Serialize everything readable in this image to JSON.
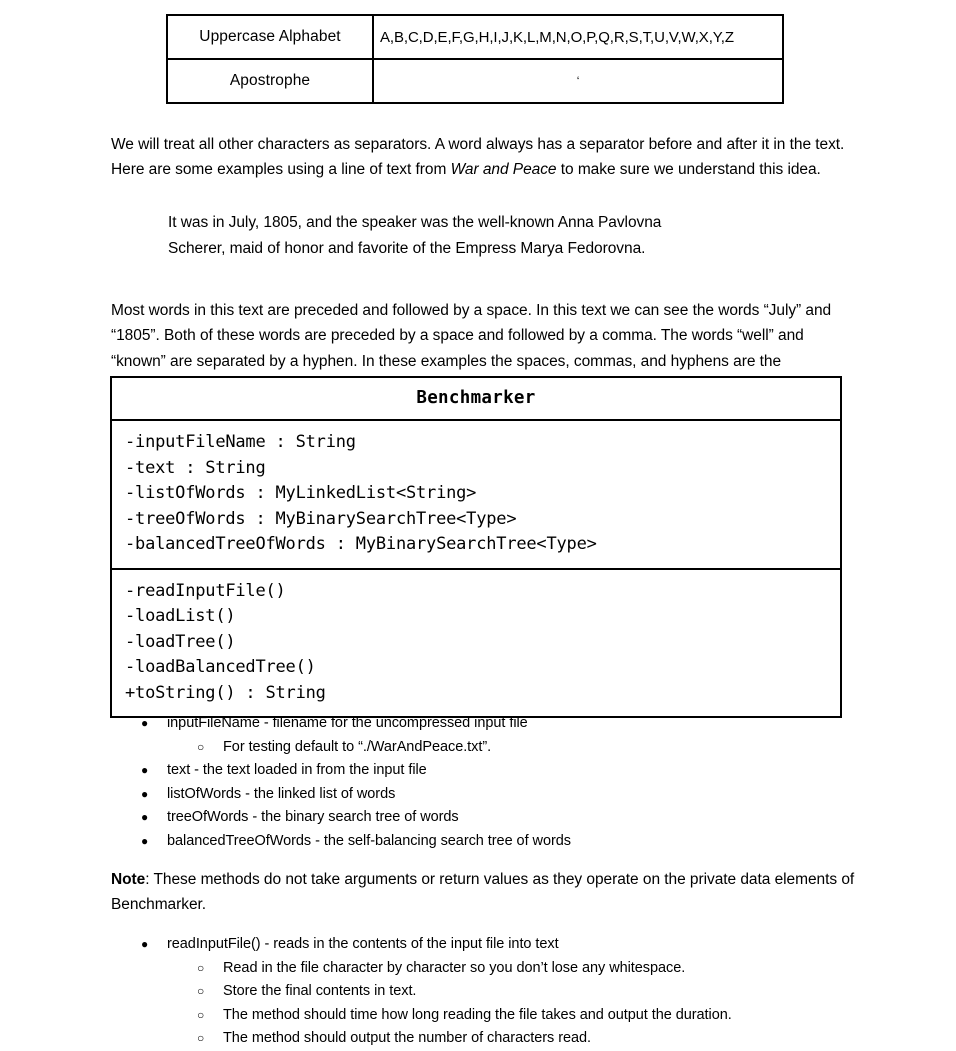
{
  "char_table": {
    "rows": [
      {
        "label": "Uppercase Alphabet",
        "value": "A,B,C,D,E,F,G,H,I,J,K,L,M,N,O,P,Q,R,S,T,U,V,W,X,Y,Z",
        "centered": false
      },
      {
        "label": "Apostrophe",
        "value": "‘",
        "centered": true
      }
    ]
  },
  "paragraphs": {
    "intro_before_italic": "We will treat all other characters as separators.  A word always has a separator before and after it in the text.  Here are some examples using a line of text from ",
    "intro_italic": "War and Peace",
    "intro_after_italic": " to make sure we understand this idea.",
    "quote_line1": "It was in July, 1805, and the speaker was the well-known Anna Pavlovna",
    "quote_line2": "Scherer, maid of honor and favorite of the Empress Marya Fedorovna.",
    "explanation": "Most words in this text are preceded and followed by a space.  In this text we can see the words “July” and “1805”.  Both of these words are preceded by a space and followed by a comma.  The words “well” and “known” are separated by a hyphen.  In these examples the spaces, commas, and hyphens are the separators."
  },
  "uml": {
    "title": "Benchmarker",
    "attributes": [
      "-inputFileName : String",
      "-text : String",
      "-listOfWords : MyLinkedList<String>",
      "-treeOfWords : MyBinarySearchTree<Type>",
      "-balancedTreeOfWords : MyBinarySearchTree<Type>"
    ],
    "methods": [
      "-readInputFile()",
      "-loadList()",
      "-loadTree()",
      "-loadBalancedTree()",
      "+toString() : String"
    ]
  },
  "field_descriptions": [
    {
      "level": 1,
      "marker": "●",
      "text": "inputFileName - filename for the uncompressed input file"
    },
    {
      "level": 2,
      "marker": "○",
      "text": "For testing default to “./WarAndPeace.txt”."
    },
    {
      "level": 1,
      "marker": "●",
      "text": "text - the text loaded in from the input file"
    },
    {
      "level": 1,
      "marker": "●",
      "text": "listOfWords - the linked list of words"
    },
    {
      "level": 1,
      "marker": "●",
      "text": "treeOfWords - the binary search tree of words"
    },
    {
      "level": 1,
      "marker": "●",
      "text": "balancedTreeOfWords - the self-balancing search tree of words"
    }
  ],
  "note": {
    "label": "Note",
    "body": ": These methods do not take arguments or return values as they operate on the private data elements of Benchmarker."
  },
  "method_descriptions": [
    {
      "level": 1,
      "marker": "●",
      "text": "readInputFile() - reads in the contents of the input file into text"
    },
    {
      "level": 2,
      "marker": "○",
      "text": "Read in the file character by character so you don’t lose any whitespace."
    },
    {
      "level": 2,
      "marker": "○",
      "text": "Store the final contents in text."
    },
    {
      "level": 2,
      "marker": "○",
      "text": "The method should time how long reading the file takes and output the duration."
    },
    {
      "level": 2,
      "marker": "○",
      "text": "The method should output the number of characters read."
    }
  ]
}
